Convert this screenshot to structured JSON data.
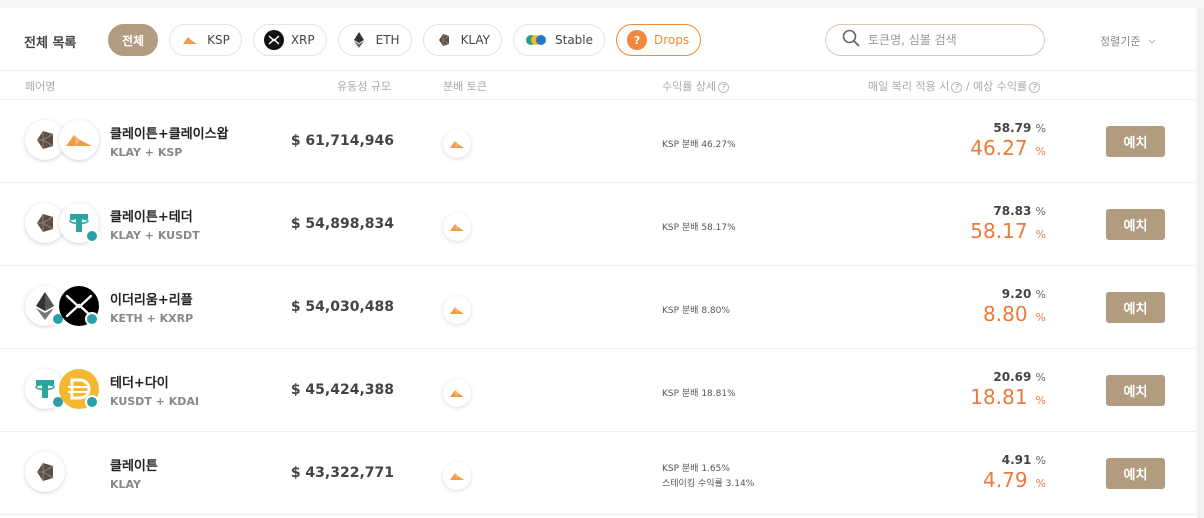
{
  "filter": {
    "list_title": "전체 목록",
    "chips": [
      {
        "label": "전체",
        "icon": "none",
        "active": true
      },
      {
        "label": "KSP",
        "icon": "ksp-icon"
      },
      {
        "label": "XRP",
        "icon": "xrp-icon"
      },
      {
        "label": "ETH",
        "icon": "eth-icon"
      },
      {
        "label": "KLAY",
        "icon": "klay-icon"
      },
      {
        "label": "Stable",
        "icon": "stable-icon"
      },
      {
        "label": "Drops",
        "icon": "drops-icon",
        "highlight": true
      }
    ],
    "search_placeholder": "토큰명, 심볼 검색",
    "sort_label": "정렬기준"
  },
  "header": {
    "pair": "페어명",
    "liquidity": "유동성 규모",
    "dist_token": "분배 토큰",
    "yield_detail": "수익률 상세",
    "compound_label": "매일 복리 적용 시",
    "separator": "/",
    "expected_label": "예상 수익률"
  },
  "rows": [
    {
      "name": "클레이튼+클레이스왑",
      "symbols": "KLAY + KSP",
      "liquidity": "$ 61,714,946",
      "details": [
        "KSP 분배 46.27%"
      ],
      "apy": "58.79",
      "apr": "46.27",
      "pct": "%",
      "deposit": "예치",
      "tokens": [
        "klay-icon",
        "ksp-icon"
      ]
    },
    {
      "name": "클레이튼+테더",
      "symbols": "KLAY + KUSDT",
      "liquidity": "$ 54,898,834",
      "details": [
        "KSP 분배 58.17%"
      ],
      "apy": "78.83",
      "apr": "58.17",
      "pct": "%",
      "deposit": "예치",
      "tokens": [
        "klay-icon",
        "kusdt-icon"
      ]
    },
    {
      "name": "이더리움+리플",
      "symbols": "KETH + KXRP",
      "liquidity": "$ 54,030,488",
      "details": [
        "KSP 분배 8.80%"
      ],
      "apy": "9.20",
      "apr": "8.80",
      "pct": "%",
      "deposit": "예치",
      "tokens": [
        "keth-icon",
        "kxrp-icon"
      ]
    },
    {
      "name": "테더+다이",
      "symbols": "KUSDT + KDAI",
      "liquidity": "$ 45,424,388",
      "details": [
        "KSP 분배 18.81%"
      ],
      "apy": "20.69",
      "apr": "18.81",
      "pct": "%",
      "deposit": "예치",
      "tokens": [
        "kusdt-icon",
        "kdai-icon"
      ]
    },
    {
      "name": "클레이튼",
      "symbols": "KLAY",
      "liquidity": "$ 43,322,771",
      "details": [
        "KSP 분배 1.65%",
        "스테이킹 수익률 3.14%"
      ],
      "apy": "4.91",
      "apr": "4.79",
      "pct": "%",
      "deposit": "예치",
      "tokens": [
        "klay-icon"
      ]
    }
  ],
  "colors": {
    "accent": "#b29c80",
    "orange": "#ec7a3c",
    "drops": "#f08a3a",
    "teal": "#2a9fa8"
  }
}
